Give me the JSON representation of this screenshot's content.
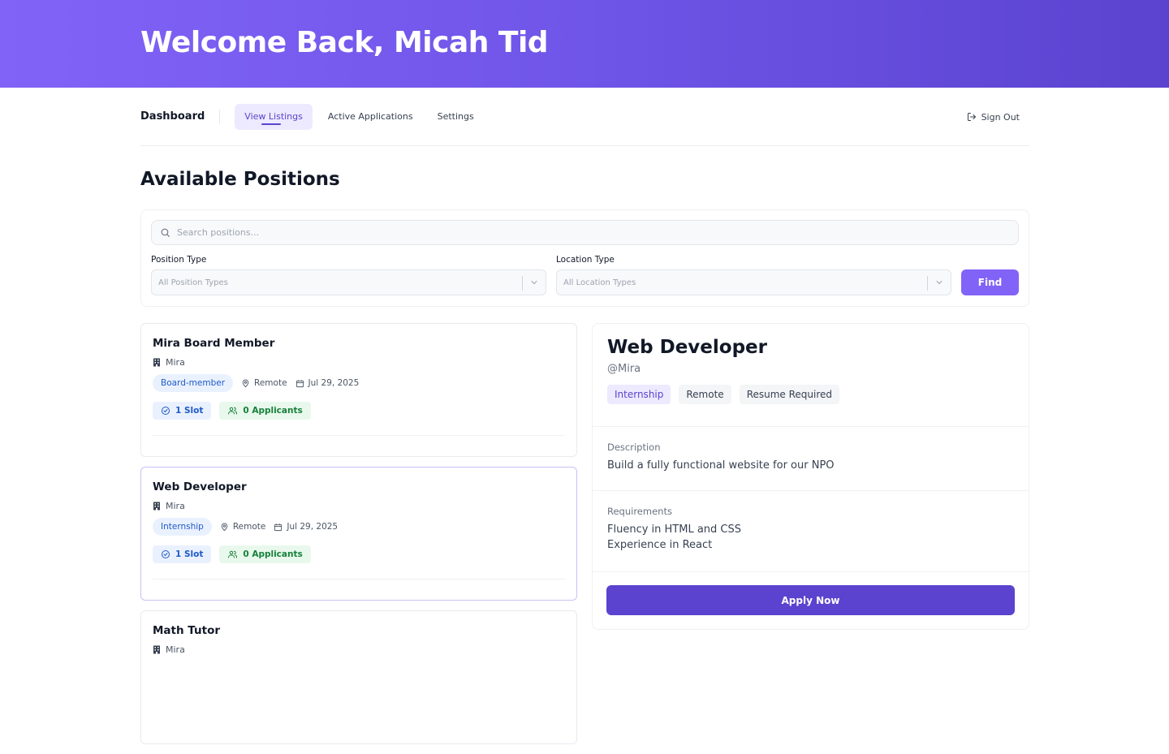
{
  "hero": {
    "title": "Welcome Back, Micah Tid"
  },
  "nav": {
    "brand": "Dashboard",
    "links": [
      "View Listings",
      "Active Applications",
      "Settings"
    ],
    "signout": "Sign Out"
  },
  "page": {
    "title": "Available Positions"
  },
  "filters": {
    "search_placeholder": "Search positions...",
    "position_type_label": "Position Type",
    "position_type_value": "All Position Types",
    "location_type_label": "Location Type",
    "location_type_value": "All Location Types",
    "find_label": "Find"
  },
  "jobs": [
    {
      "title": "Mira Board Member",
      "org": "Mira",
      "type": "Board-member",
      "location": "Remote",
      "date": "Jul 29, 2025",
      "slots": "1 Slot",
      "applicants": "0 Applicants"
    },
    {
      "title": "Web Developer",
      "org": "Mira",
      "type": "Internship",
      "location": "Remote",
      "date": "Jul 29, 2025",
      "slots": "1 Slot",
      "applicants": "0 Applicants"
    },
    {
      "title": "Math Tutor",
      "org": "Mira"
    }
  ],
  "detail": {
    "title": "Web Developer",
    "handle": "@Mira",
    "tags": [
      "Internship",
      "Remote",
      "Resume Required"
    ],
    "description_label": "Description",
    "description": "Build a fully functional website for our NPO",
    "requirements_label": "Requirements",
    "requirements": [
      "Fluency in HTML and CSS",
      "Experience in React"
    ],
    "apply_label": "Apply Now"
  },
  "colors": {
    "accent": "#8263f7",
    "primary": "#5b43cf",
    "hero_start": "#8263f7",
    "hero_end": "#5b43cf"
  }
}
